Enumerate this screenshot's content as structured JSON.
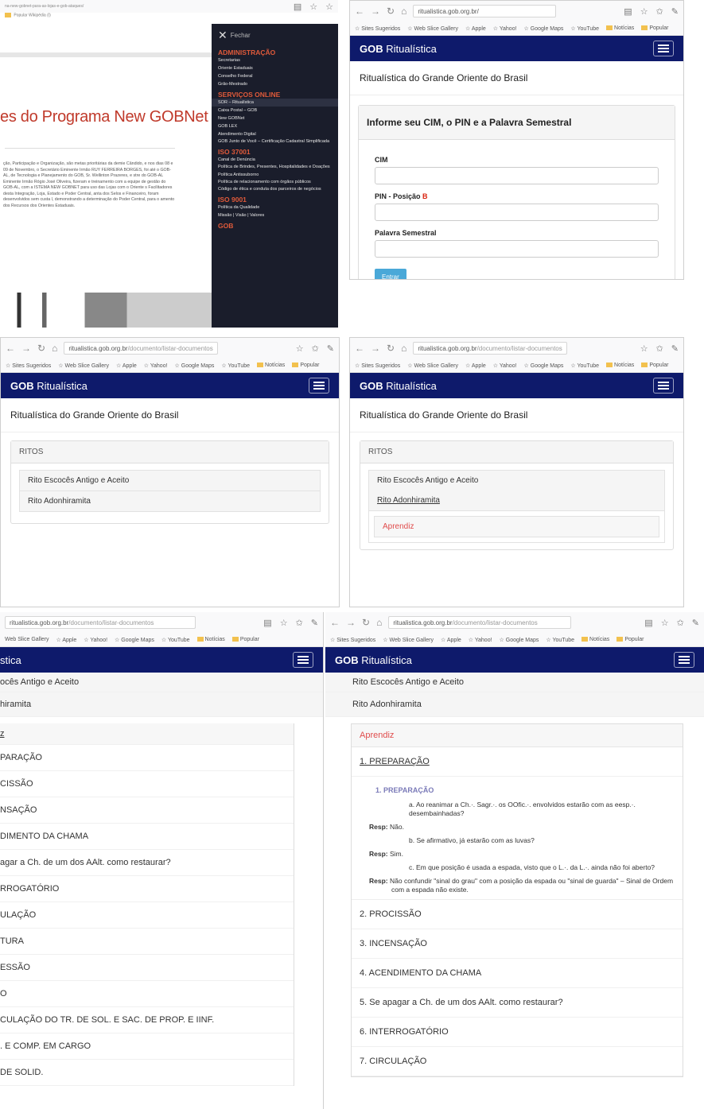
{
  "colors": {
    "header": "#0e1a6b",
    "accent_red": "#e04c4c",
    "menu_bg": "#1a1d2b",
    "button": "#4aa8d8"
  },
  "browser": {
    "url_host": "ritualistica.gob.org.br",
    "url_path": "/documento/listar-documentos",
    "url_root": "ritualistica.gob.org.br/",
    "bookmarks": [
      "Sites Sugeridos",
      "Web Slice Gallery",
      "Apple",
      "Yahoo!",
      "Google Maps",
      "YouTube",
      "Notícias",
      "Popular"
    ]
  },
  "panel1": {
    "topbar_url": "na-new-gobnet-para-as-lojas-e-gob-ataques/",
    "bookmarks_text": "Popular   Wikipédia (I)",
    "heading": "es do Programa New GOBNet",
    "body": "ção, Participação e Organização, são metas prioritárias da demie Cândido, e nos dias 08 e 09 de Novembro, o Secretário Eminente Irmão RUY FERREIRA BORGES, foi até o GOB-AL, de Tecnologia e Planejamento do GOB, Sr. Wellinton Prazeres, e stre do GOB-AL Eminente Irmão Rógio José Oliveira, fizeram e treinamento com a equipe de gestão do GOB-AL, com a ISTEMA NEW GOBNET para uso das Lojas com o Oriente s Facilitadores desta Integração, Loja, Estado e Poder Central, anta dos Selos e Financeiro, foram desenvolvidos sem custa l, demonstrando a determinação do Poder Central, para o amento dos Recursos dos Orientes Estaduais.",
    "menu": {
      "close": "Fechar",
      "sections": [
        {
          "title": "ADMINISTRAÇÃO",
          "items": [
            "Secretarias",
            "Oriente Estaduais",
            "Conselho Federal",
            "Grão-Mestrado"
          ]
        },
        {
          "title": "SERVIÇOS ONLINE",
          "items": [
            "SOR – Ritualística",
            "Caixa Postal – GOB",
            "New GOBNet",
            "GOB LEX",
            "Atendimento Digital",
            "GOB Junto de Você – Certificação Cadastral Simplificada"
          ]
        },
        {
          "title": "ISO 37001",
          "items": [
            "Canal de Denúncia",
            "Política de Brindes, Presentes, Hospitalidades e Doações",
            "Política Antissuborno",
            "Política de relacionamento com órgãos públicos",
            "Código de ética e conduta dos parceiros de negócios"
          ]
        },
        {
          "title": "ISO 9001",
          "items": [
            "Política da Qualidade",
            "Missão | Visão | Valores"
          ]
        },
        {
          "title": "GOB",
          "items": []
        }
      ]
    }
  },
  "app": {
    "brand_bold": "GOB",
    "brand_rest": " Ritualística",
    "subtitle": "Ritualística do Grande Oriente do Brasil"
  },
  "login": {
    "title": "Informe seu CIM, o PIN e a Palavra Semestral",
    "cim_label": "CIM",
    "pin_label": "PIN - Posição ",
    "pin_position": "B",
    "palavra_label": "Palavra Semestral",
    "submit": "Entrar"
  },
  "ritos": {
    "header": "RITOS",
    "items": [
      "Rito Escocês Antigo e Aceito",
      "Rito Adonhiramita"
    ],
    "grau": "Aprendiz"
  },
  "panel5": {
    "rows": [
      "ocês Antigo e Aceito",
      "hiramita",
      "z",
      "PARAÇÃO",
      "CISSÃO",
      "NSAÇÃO",
      "DIMENTO DA CHAMA",
      "agar a Ch. de um dos AAlt. como restaurar?",
      "RROGATÓRIO",
      "ULAÇÃO",
      "TURA",
      "ESSÃO",
      "O",
      "CULAÇÃO DO TR. DE SOL. E SAC. DE PROP. E IINF.",
      ". E COMP. EM CARGO",
      "DE SOLID."
    ]
  },
  "panel6": {
    "section_link": "1. PREPARAÇÃO",
    "detail_title": "1.  PREPARAÇÃO",
    "qa": [
      {
        "q": "a.  Ao reanimar a Ch.·. Sagr.·. os OOfic.·. envolvidos estarão com as eesp.·. desembainhadas?",
        "r_label": "Resp:",
        "r": " Não."
      },
      {
        "q": "b.  Se afirmativo, já estarão com as luvas?",
        "r_label": "Resp:",
        "r": " Sim."
      },
      {
        "q": "c.  Em que posição é usada a espada, visto que o L.·. da L.·. ainda não foi aberto?",
        "r_label": "Resp:",
        "r": " Não confundir \"sinal do grau\" com a posição da espada ou \"sinal de guarda\" – Sinal de Ordem com a espada não existe."
      }
    ],
    "sections": [
      "2. PROCISSÃO",
      "3. INCENSAÇÃO",
      "4. ACENDIMENTO DA CHAMA",
      "5. Se apagar a Ch. de um dos AAlt. como restaurar?",
      "6. INTERROGATÓRIO",
      "7. CIRCULAÇÃO"
    ]
  }
}
